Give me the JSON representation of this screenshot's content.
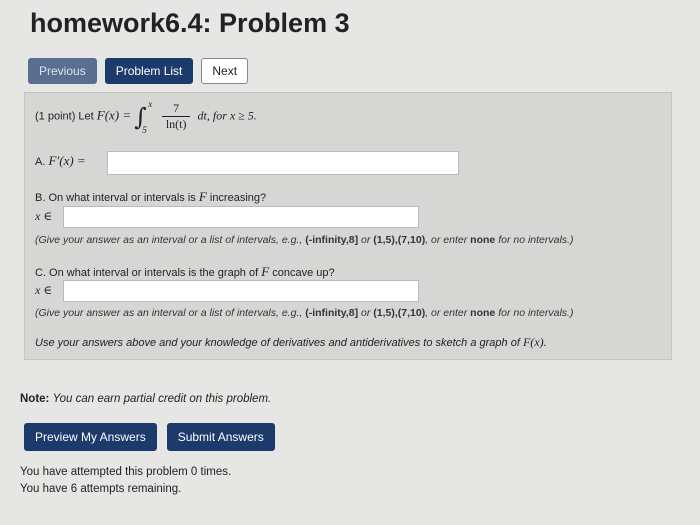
{
  "page": {
    "title": "homework6.4: Problem 3"
  },
  "nav": {
    "previous": "Previous",
    "problem_list": "Problem List",
    "next": "Next"
  },
  "problem": {
    "points": "(1 point) Let",
    "function": "F(x) =",
    "upper_limit": "x",
    "lower_limit": "5",
    "numerator": "7",
    "denominator": "ln(t)",
    "after_integral": "dt, for x ≥ 5.",
    "part_a": {
      "label": "A.",
      "expr": "F′(x) =",
      "value": ""
    },
    "part_b": {
      "question": "B. On what interval or intervals is",
      "var": "F",
      "question_end": "increasing?",
      "prefix": "x ∈",
      "value": "",
      "hint_pre": "(Give your answer as an interval or a list of intervals, e.g.,",
      "hint_ex1": "(-infinity,8]",
      "hint_mid": "or",
      "hint_ex2": "(1,5),(7,10)",
      "hint_mid2": ", or enter",
      "hint_none": "none",
      "hint_end": "for no intervals.)"
    },
    "part_c": {
      "question": "C. On what interval or intervals is the graph of",
      "var": "F",
      "question_end": "concave up?",
      "prefix": "x ∈",
      "value": "",
      "hint_pre": "(Give your answer as an interval or a list of intervals, e.g.,",
      "hint_ex1": "(-infinity,8]",
      "hint_mid": "or",
      "hint_ex2": "(1,5),(7,10)",
      "hint_mid2": ", or enter",
      "hint_none": "none",
      "hint_end": "for no intervals.)"
    },
    "sketch": "Use your answers above and your knowledge of derivatives and antiderivatives to sketch a graph of",
    "sketch_func": "F(x)."
  },
  "note": {
    "label": "Note:",
    "text": "You can earn partial credit on this problem."
  },
  "actions": {
    "preview": "Preview My Answers",
    "submit": "Submit Answers"
  },
  "status": {
    "attempts": "You have attempted this problem 0 times.",
    "remaining": "You have 6 attempts remaining."
  }
}
